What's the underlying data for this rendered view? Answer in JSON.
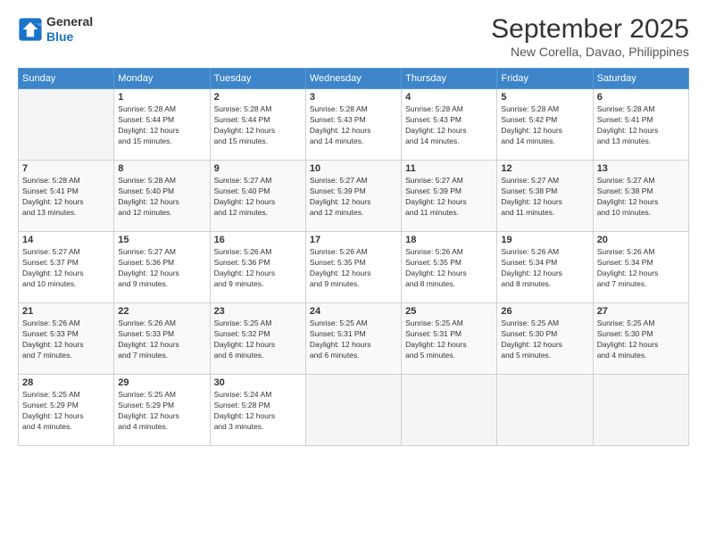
{
  "logo": {
    "line1": "General",
    "line2": "Blue"
  },
  "title": "September 2025",
  "subtitle": "New Corella, Davao, Philippines",
  "days_of_week": [
    "Sunday",
    "Monday",
    "Tuesday",
    "Wednesday",
    "Thursday",
    "Friday",
    "Saturday"
  ],
  "weeks": [
    [
      {
        "num": "",
        "info": ""
      },
      {
        "num": "1",
        "info": "Sunrise: 5:28 AM\nSunset: 5:44 PM\nDaylight: 12 hours\nand 15 minutes."
      },
      {
        "num": "2",
        "info": "Sunrise: 5:28 AM\nSunset: 5:44 PM\nDaylight: 12 hours\nand 15 minutes."
      },
      {
        "num": "3",
        "info": "Sunrise: 5:28 AM\nSunset: 5:43 PM\nDaylight: 12 hours\nand 14 minutes."
      },
      {
        "num": "4",
        "info": "Sunrise: 5:28 AM\nSunset: 5:43 PM\nDaylight: 12 hours\nand 14 minutes."
      },
      {
        "num": "5",
        "info": "Sunrise: 5:28 AM\nSunset: 5:42 PM\nDaylight: 12 hours\nand 14 minutes."
      },
      {
        "num": "6",
        "info": "Sunrise: 5:28 AM\nSunset: 5:41 PM\nDaylight: 12 hours\nand 13 minutes."
      }
    ],
    [
      {
        "num": "7",
        "info": "Sunrise: 5:28 AM\nSunset: 5:41 PM\nDaylight: 12 hours\nand 13 minutes."
      },
      {
        "num": "8",
        "info": "Sunrise: 5:28 AM\nSunset: 5:40 PM\nDaylight: 12 hours\nand 12 minutes."
      },
      {
        "num": "9",
        "info": "Sunrise: 5:27 AM\nSunset: 5:40 PM\nDaylight: 12 hours\nand 12 minutes."
      },
      {
        "num": "10",
        "info": "Sunrise: 5:27 AM\nSunset: 5:39 PM\nDaylight: 12 hours\nand 12 minutes."
      },
      {
        "num": "11",
        "info": "Sunrise: 5:27 AM\nSunset: 5:39 PM\nDaylight: 12 hours\nand 11 minutes."
      },
      {
        "num": "12",
        "info": "Sunrise: 5:27 AM\nSunset: 5:38 PM\nDaylight: 12 hours\nand 11 minutes."
      },
      {
        "num": "13",
        "info": "Sunrise: 5:27 AM\nSunset: 5:38 PM\nDaylight: 12 hours\nand 10 minutes."
      }
    ],
    [
      {
        "num": "14",
        "info": "Sunrise: 5:27 AM\nSunset: 5:37 PM\nDaylight: 12 hours\nand 10 minutes."
      },
      {
        "num": "15",
        "info": "Sunrise: 5:27 AM\nSunset: 5:36 PM\nDaylight: 12 hours\nand 9 minutes."
      },
      {
        "num": "16",
        "info": "Sunrise: 5:26 AM\nSunset: 5:36 PM\nDaylight: 12 hours\nand 9 minutes."
      },
      {
        "num": "17",
        "info": "Sunrise: 5:26 AM\nSunset: 5:35 PM\nDaylight: 12 hours\nand 9 minutes."
      },
      {
        "num": "18",
        "info": "Sunrise: 5:26 AM\nSunset: 5:35 PM\nDaylight: 12 hours\nand 8 minutes."
      },
      {
        "num": "19",
        "info": "Sunrise: 5:26 AM\nSunset: 5:34 PM\nDaylight: 12 hours\nand 8 minutes."
      },
      {
        "num": "20",
        "info": "Sunrise: 5:26 AM\nSunset: 5:34 PM\nDaylight: 12 hours\nand 7 minutes."
      }
    ],
    [
      {
        "num": "21",
        "info": "Sunrise: 5:26 AM\nSunset: 5:33 PM\nDaylight: 12 hours\nand 7 minutes."
      },
      {
        "num": "22",
        "info": "Sunrise: 5:26 AM\nSunset: 5:33 PM\nDaylight: 12 hours\nand 7 minutes."
      },
      {
        "num": "23",
        "info": "Sunrise: 5:25 AM\nSunset: 5:32 PM\nDaylight: 12 hours\nand 6 minutes."
      },
      {
        "num": "24",
        "info": "Sunrise: 5:25 AM\nSunset: 5:31 PM\nDaylight: 12 hours\nand 6 minutes."
      },
      {
        "num": "25",
        "info": "Sunrise: 5:25 AM\nSunset: 5:31 PM\nDaylight: 12 hours\nand 5 minutes."
      },
      {
        "num": "26",
        "info": "Sunrise: 5:25 AM\nSunset: 5:30 PM\nDaylight: 12 hours\nand 5 minutes."
      },
      {
        "num": "27",
        "info": "Sunrise: 5:25 AM\nSunset: 5:30 PM\nDaylight: 12 hours\nand 4 minutes."
      }
    ],
    [
      {
        "num": "28",
        "info": "Sunrise: 5:25 AM\nSunset: 5:29 PM\nDaylight: 12 hours\nand 4 minutes."
      },
      {
        "num": "29",
        "info": "Sunrise: 5:25 AM\nSunset: 5:29 PM\nDaylight: 12 hours\nand 4 minutes."
      },
      {
        "num": "30",
        "info": "Sunrise: 5:24 AM\nSunset: 5:28 PM\nDaylight: 12 hours\nand 3 minutes."
      },
      {
        "num": "",
        "info": ""
      },
      {
        "num": "",
        "info": ""
      },
      {
        "num": "",
        "info": ""
      },
      {
        "num": "",
        "info": ""
      }
    ]
  ]
}
